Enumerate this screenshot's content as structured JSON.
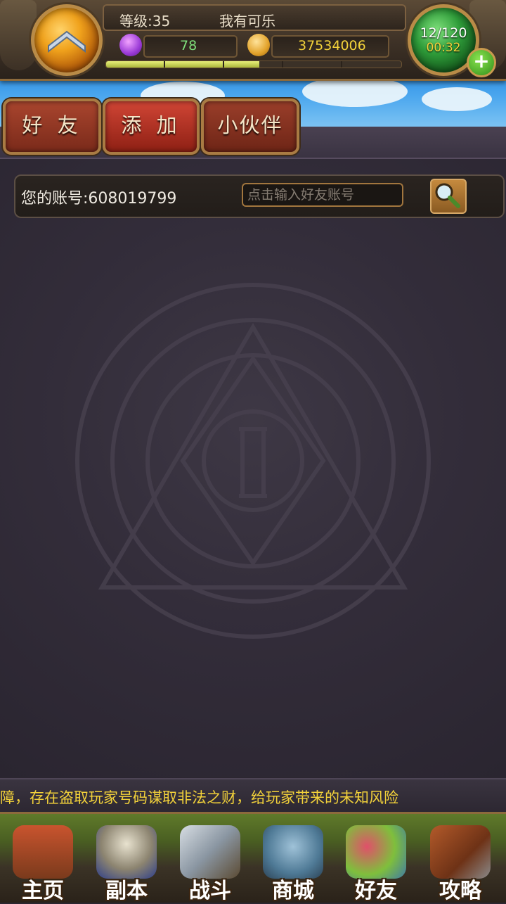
{
  "header": {
    "level_label": "等级:35",
    "player_name": "我有可乐",
    "gems": "78",
    "gold": "37534006",
    "stamina": "12/120",
    "timer": "00:32",
    "exp_progress": 0.52,
    "add_stamina_label": "+"
  },
  "tabs": [
    {
      "label": "好 友"
    },
    {
      "label": "添 加"
    },
    {
      "label": "小伙伴"
    }
  ],
  "account": {
    "label": "您的账号:",
    "id": "608019799",
    "search_placeholder": "点击输入好友账号"
  },
  "ticker": {
    "text": "障，存在盗取玩家号码谋取非法之财，给玩家带来的未知风险"
  },
  "nav": [
    {
      "label": "主页",
      "icon": "house-icon"
    },
    {
      "label": "副本",
      "icon": "skull-icon"
    },
    {
      "label": "战斗",
      "icon": "sword-icon"
    },
    {
      "label": "商城",
      "icon": "monster-shop-icon"
    },
    {
      "label": "好友",
      "icon": "friends-icon"
    },
    {
      "label": "攻略",
      "icon": "guide-book-icon"
    }
  ],
  "colors": {
    "ticker_text": "#f3d23a",
    "gem_value": "#7fe07b",
    "gold_value": "#f3d23a"
  }
}
